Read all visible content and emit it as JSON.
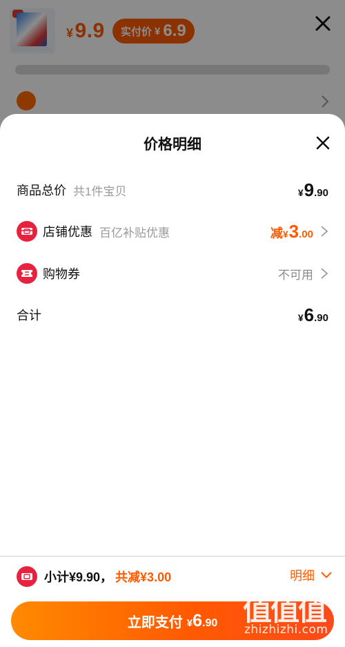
{
  "background": {
    "price_currency": "¥",
    "price_value": "9.9",
    "pill_label": "实付价",
    "pill_currency": "¥",
    "pill_value": "6.9"
  },
  "sheet": {
    "title": "价格明细",
    "rows": {
      "total": {
        "label": "商品总价",
        "sub": "共1件宝贝",
        "currency": "¥",
        "int": "9",
        "dec": ".90"
      },
      "shop_discount": {
        "label": "店铺优惠",
        "sub": "百亿补贴优惠",
        "prefix": "减",
        "currency": "¥",
        "int": "3",
        "dec": ".00"
      },
      "coupon": {
        "label": "购物券",
        "status": "不可用"
      },
      "sum": {
        "label": "合计",
        "currency": "¥",
        "int": "6",
        "dec": ".90"
      }
    }
  },
  "bottom_bar": {
    "subtotal_text": "小计¥9.90，",
    "reduced_text": "共减¥3.00",
    "detail_label": "明细",
    "pay_label": "立即支付",
    "pay_currency": "¥",
    "pay_int": "6",
    "pay_dec": ".90"
  },
  "watermark": {
    "glyphs": "值值值",
    "site": "zhizhizhi.com"
  },
  "colors": {
    "accent": "#ff5a00",
    "badge": "#e8213f",
    "muted": "#9a9a9a"
  },
  "icons": [
    "close-icon",
    "shop-coupon-icon",
    "ticket-icon",
    "chevron-right-icon",
    "chevron-down-icon",
    "location-icon"
  ]
}
